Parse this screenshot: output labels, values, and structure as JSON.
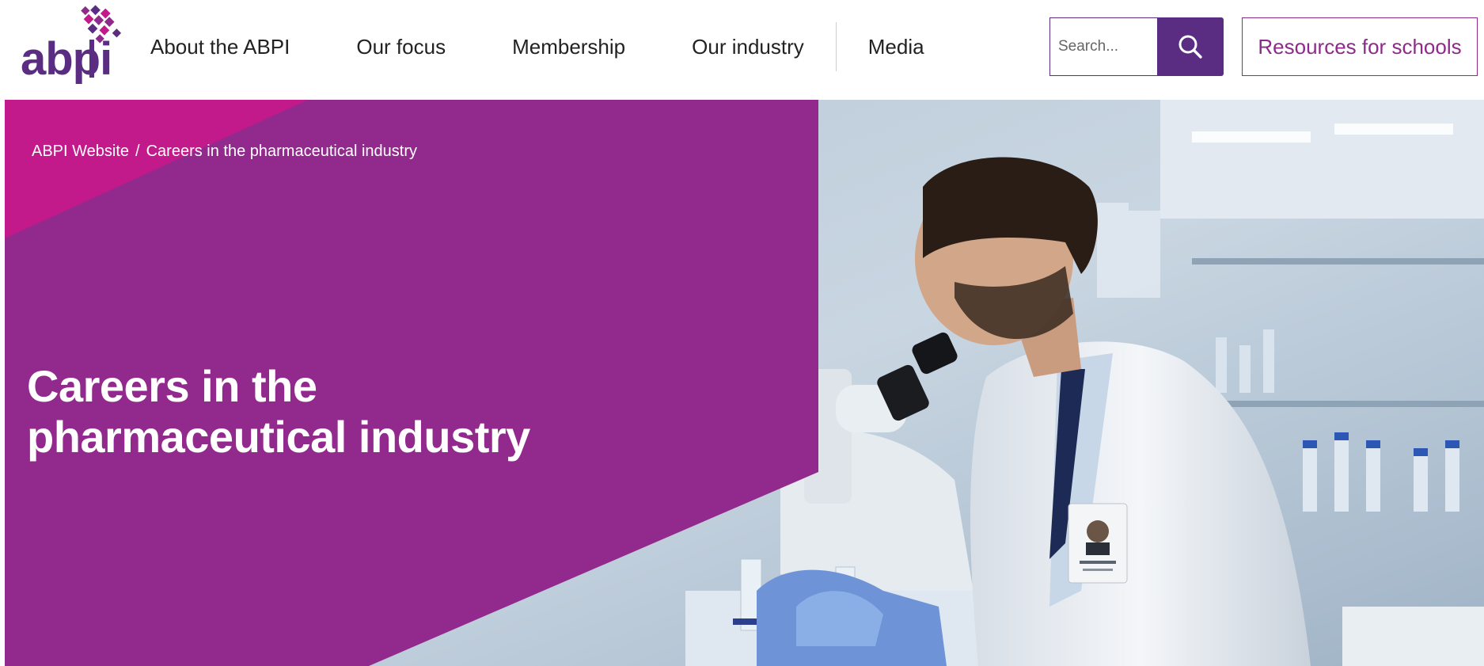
{
  "header": {
    "logo_text": "abpi",
    "nav": [
      {
        "label": "About the ABPI"
      },
      {
        "label": "Our focus"
      },
      {
        "label": "Membership"
      },
      {
        "label": "Our industry"
      },
      {
        "label": "Media"
      }
    ],
    "search": {
      "placeholder": "Search...",
      "icon": "search-icon"
    },
    "resources_button": "Resources for schools"
  },
  "hero": {
    "breadcrumb": [
      {
        "label": "ABPI Website"
      },
      {
        "label": "Careers in the pharmaceutical industry"
      }
    ],
    "breadcrumb_separator": "/",
    "title_line1": "Careers in the",
    "title_line2": "pharmaceutical industry"
  },
  "colors": {
    "brand_purple": "#5a2d82",
    "hero_purple": "#922a8e",
    "hero_magenta": "#c2198b"
  }
}
